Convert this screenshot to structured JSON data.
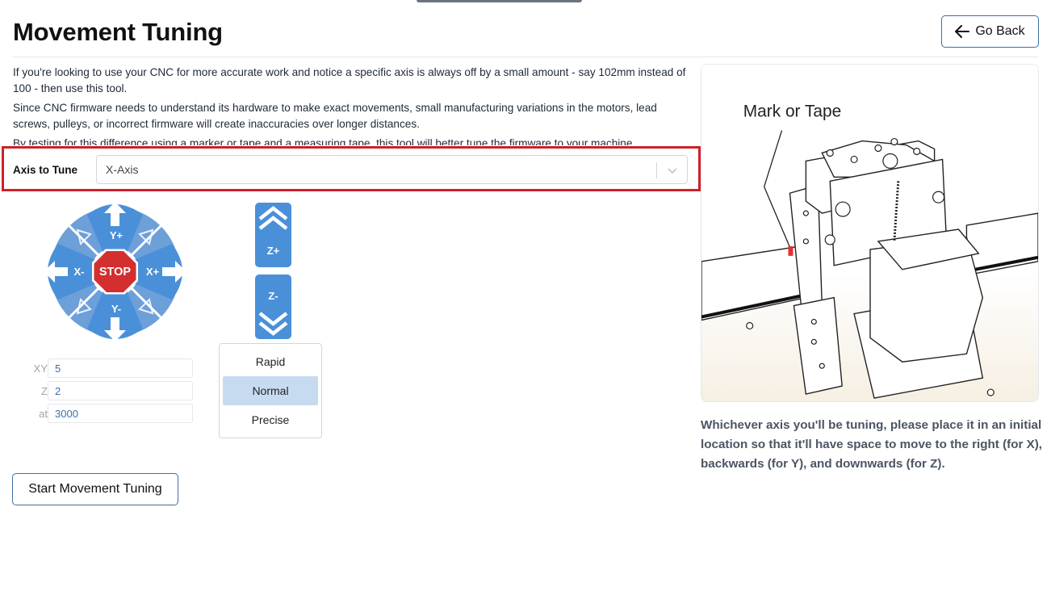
{
  "page": {
    "title": "Movement Tuning",
    "go_back_label": "Go Back"
  },
  "description": {
    "p1": "If you're looking to use your CNC for more accurate work and notice a specific axis is always off by a small amount - say 102mm instead of 100 - then use this tool.",
    "p2": "Since CNC firmware needs to understand its hardware to make exact movements, small manufacturing variations in the motors, lead screws, pulleys, or incorrect firmware will create inaccuracies over longer distances.",
    "p3": "By testing for this difference using a marker or tape and a measuring tape, this tool will better tune the firmware to your machine."
  },
  "axis_select": {
    "label": "Axis to Tune",
    "value": "X-Axis"
  },
  "jog": {
    "stop_label": "STOP",
    "y_plus": "Y+",
    "y_minus": "Y-",
    "x_plus": "X+",
    "x_minus": "X-",
    "z_plus": "Z+",
    "z_minus": "Z-"
  },
  "step_fields": [
    {
      "label": "XY",
      "value": "5"
    },
    {
      "label": "Z",
      "value": "2"
    },
    {
      "label": "at",
      "value": "3000"
    }
  ],
  "speed_options": [
    {
      "label": "Rapid",
      "active": false
    },
    {
      "label": "Normal",
      "active": true
    },
    {
      "label": "Precise",
      "active": false
    }
  ],
  "start_button": "Start Movement Tuning",
  "illustration": {
    "callout": "Mark or Tape"
  },
  "instruction": "Whichever axis you'll be tuning, please place it in an initial location so that it'll have space to move to the right (for X), backwards (for Y), and downwards (for Z).",
  "colors": {
    "jog_blue": "#4a90d9",
    "jog_light": "#80aee0",
    "stop_red": "#d32f2f",
    "highlight_red": "#cc2229",
    "accent_border": "#3e6fa3",
    "active_option": "#c7dbf0"
  }
}
